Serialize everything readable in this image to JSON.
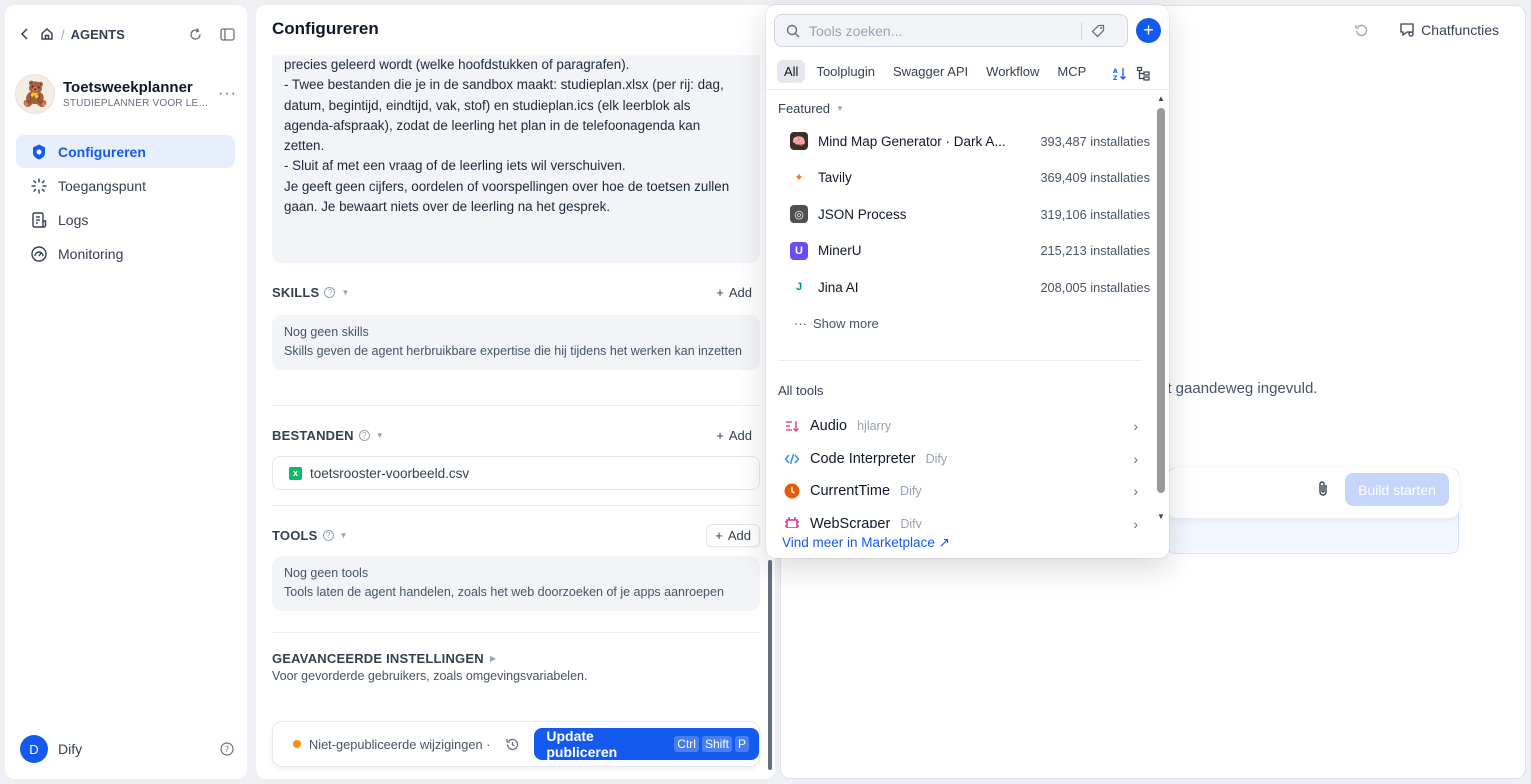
{
  "sidebar": {
    "breadcrumb": "AGENTS",
    "app_name": "Toetsweekplanner",
    "app_subtitle": "STUDIEPLANNER VOOR LEE...",
    "app_emoji": "🧸",
    "nav": [
      {
        "label": "Configureren",
        "icon": "eye-shield-icon",
        "active": true
      },
      {
        "label": "Toegangspunt",
        "icon": "entry-point-icon",
        "active": false
      },
      {
        "label": "Logs",
        "icon": "logs-icon",
        "active": false
      },
      {
        "label": "Monitoring",
        "icon": "gauge-icon",
        "active": false
      }
    ],
    "user_initial": "D",
    "user_name": "Dify"
  },
  "config": {
    "title": "Configureren",
    "prompt_lines": [
      "precies geleerd wordt (welke hoofdstukken of paragrafen).",
      "- Twee bestanden die je in de sandbox maakt: studieplan.xlsx (per rij: dag,",
      "datum, begintijd, eindtijd, vak, stof) en studieplan.ics (elk leerblok als",
      "agenda-afspraak), zodat de leerling het plan in de telefoonagenda kan",
      "zetten.",
      "- Sluit af met een vraag of de leerling iets wil verschuiven.",
      "",
      "Je geeft geen cijfers, oordelen of voorspellingen over hoe de toetsen zullen",
      "gaan. Je bewaart niets over de leerling na het gesprek."
    ],
    "skills": {
      "title": "SKILLS",
      "add": "Add",
      "empty_title": "Nog geen skills",
      "empty_desc": "Skills geven de agent herbruikbare expertise die hij tijdens het werken kan inzetten"
    },
    "files": {
      "title": "BESTANDEN",
      "add": "Add",
      "file_name": "toetsrooster-voorbeeld.csv"
    },
    "tools": {
      "title": "TOOLS",
      "add": "Add",
      "empty_title": "Nog geen tools",
      "empty_desc": "Tools laten de agent handelen, zoals het web doorzoeken of je apps aanroepen"
    },
    "advanced": {
      "title": "GEAVANCEERDE INSTELLINGEN",
      "desc": "Voor gevorderde gebruikers, zoals omgevingsvariabelen."
    },
    "publish": {
      "status": "Niet-gepubliceerde wijzigingen ·",
      "button": "Update publiceren",
      "shortcut": [
        "Ctrl",
        "Shift",
        "P"
      ]
    }
  },
  "chat": {
    "chat_functions": "Chatfuncties",
    "body_text": "dt gaandeweg ingevuld.",
    "build_button": "Build starten"
  },
  "tools_dropdown": {
    "search_placeholder": "Tools zoeken...",
    "tabs": [
      "All",
      "Toolplugin",
      "Swagger API",
      "Workflow",
      "MCP"
    ],
    "featured_title": "Featured",
    "featured": [
      {
        "name": "Mind Map Generator · Dark A...",
        "count": "393,487 installaties",
        "color": "#3b2f2a",
        "glyph": "🧠"
      },
      {
        "name": "Tavily",
        "count": "369,409 installaties",
        "color": "#ffffff",
        "glyph": "✦"
      },
      {
        "name": "JSON Process",
        "count": "319,106 installaties",
        "color": "#505050",
        "glyph": "◎"
      },
      {
        "name": "MinerU",
        "count": "215,213 installaties",
        "color": "#6a4cf5",
        "glyph": "U"
      },
      {
        "name": "Jina AI",
        "count": "208,005 installaties",
        "color": "#ffffff",
        "glyph": "J"
      }
    ],
    "show_more": "Show more",
    "all_title": "All tools",
    "all_tools": [
      {
        "name": "Audio",
        "org": "hjlarry",
        "color": "#e0457b"
      },
      {
        "name": "Code Interpreter",
        "org": "Dify",
        "color": "#2e90fa"
      },
      {
        "name": "CurrentTime",
        "org": "Dify",
        "color": "#e9590c"
      },
      {
        "name": "WebScraper",
        "org": "Dify",
        "color": "#dd2590"
      }
    ],
    "marketplace": "Vind meer in Marketplace ↗"
  }
}
